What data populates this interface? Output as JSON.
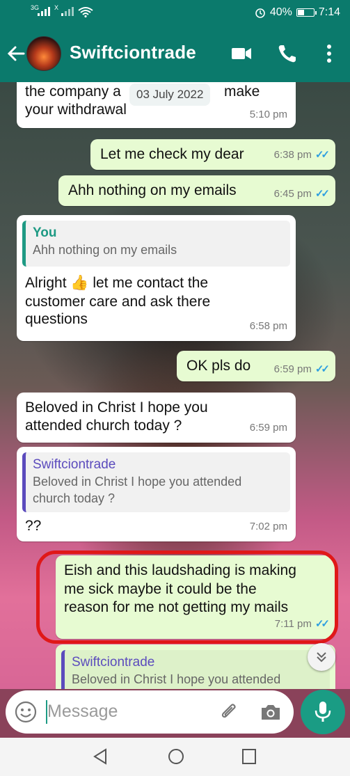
{
  "status_bar": {
    "network_a": "3G",
    "network_b": "X",
    "battery": "40%",
    "time": "7:14"
  },
  "header": {
    "contact_name": "Swiftciontrade",
    "icons": [
      "back-arrow-icon",
      "video-call-icon",
      "voice-call-icon",
      "more-options-icon"
    ]
  },
  "date_chip": "03 July 2022",
  "messages": [
    {
      "dir": "in",
      "lines": [
        "the company a",
        "your withdrawal"
      ],
      "partial_after_chip": "make",
      "time": "5:10 pm"
    },
    {
      "dir": "out",
      "text": "Let me check my dear",
      "time": "6:38 pm",
      "status": "read"
    },
    {
      "dir": "out",
      "text": "Ahh nothing on my emails",
      "time": "6:45 pm",
      "status": "read"
    },
    {
      "dir": "in",
      "quote": {
        "author": "You",
        "text": "Ahh nothing on my emails"
      },
      "lines": [
        "Alright 👍 let me contact the",
        "customer care and ask there",
        "questions"
      ],
      "time": "6:58 pm"
    },
    {
      "dir": "out",
      "text": "OK pls do",
      "time": "6:59 pm",
      "status": "read"
    },
    {
      "dir": "in",
      "lines": [
        "Beloved in Christ I hope you",
        "attended church today ?"
      ],
      "time": "6:59 pm"
    },
    {
      "dir": "in",
      "quote": {
        "author": "Swiftciontrade",
        "lines": [
          "Beloved in Christ I hope you attended",
          "church today ?"
        ]
      },
      "text": "??",
      "time": "7:02 pm"
    },
    {
      "dir": "out",
      "lines": [
        "Eish and this laudshading is making",
        "me sick maybe it could be the",
        "reason for me not getting my mails"
      ],
      "time": "7:11 pm",
      "status": "read",
      "highlighted": true
    },
    {
      "dir": "out",
      "quote": {
        "author": "Swiftciontrade",
        "text": "Beloved in Christ I hope you attended"
      }
    }
  ],
  "composer": {
    "placeholder": "Message",
    "icons": [
      "emoji-icon",
      "attach-icon",
      "camera-icon",
      "mic-icon"
    ]
  },
  "colors": {
    "header": "#0b7a6c",
    "incoming": "#ffffff",
    "outgoing": "#e7fbd2",
    "read_ticks": "#2f9fe0",
    "highlight": "#e01818",
    "mic_button": "#1a9c84"
  }
}
